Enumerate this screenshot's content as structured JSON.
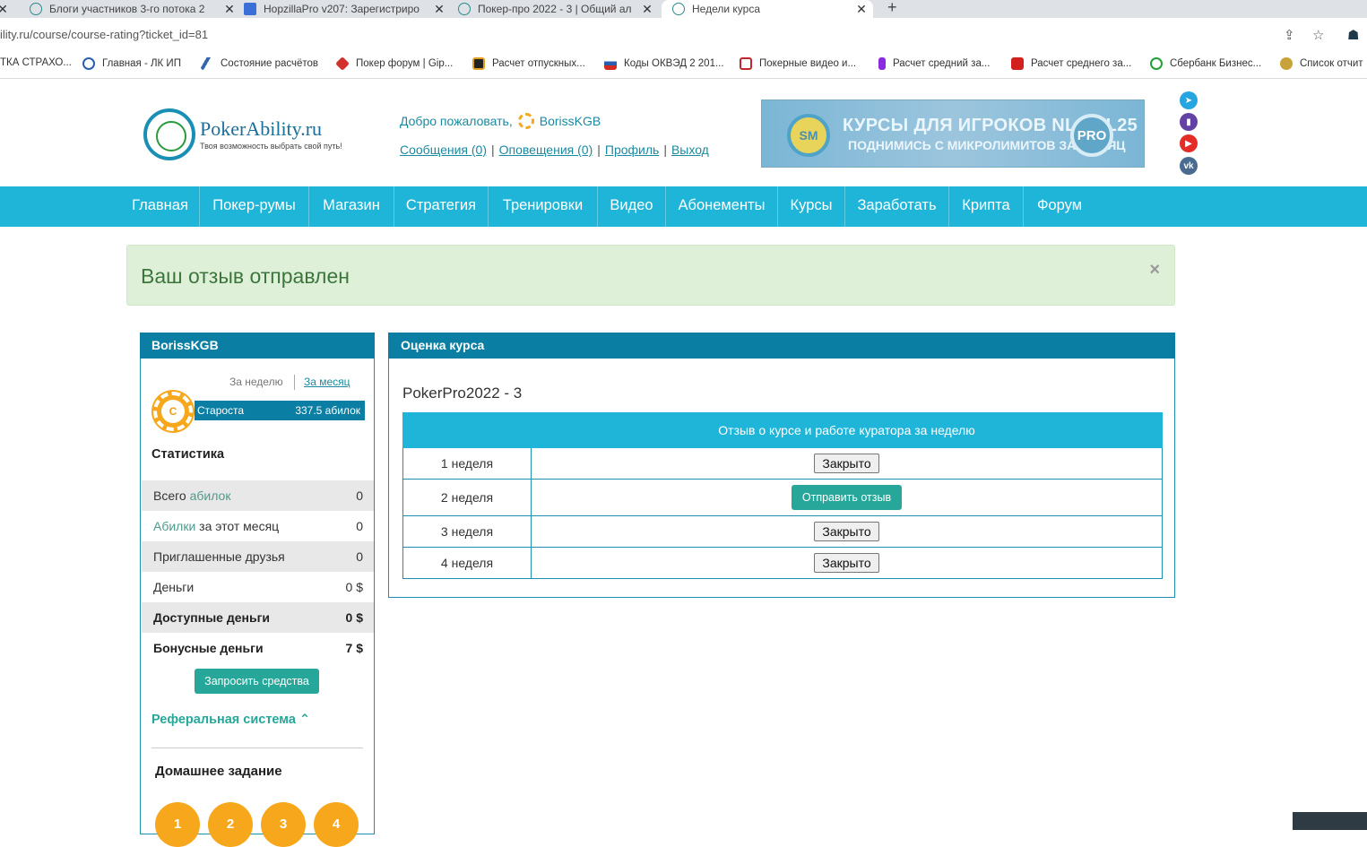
{
  "browser": {
    "tabs": [
      {
        "title": "Блоги участников 3-го потока 2",
        "active": false
      },
      {
        "title": "HopzillaPro v207: Зарегистриро",
        "active": false
      },
      {
        "title": "Покер-про 2022 - 3 | Общий ал",
        "active": false
      },
      {
        "title": "Недели курса",
        "active": true
      }
    ],
    "url": "ility.ru/course/course-rating?ticket_id=81",
    "bookmarks": [
      "ТКА СТРАХО...",
      "Главная - ЛК ИП",
      "Состояние расчётов",
      "Покер форум | Gip...",
      "Расчет отпускных...",
      "Коды ОКВЭД 2 201...",
      "Покерные видео и...",
      "Расчет средний за...",
      "Расчет среднего за...",
      "Сбербанк Бизнес...",
      "Список отчит"
    ]
  },
  "header": {
    "logo_name": "PokerAbility.ru",
    "logo_tagline": "Твоя возможность выбрать свой путь!",
    "welcome": "Добро пожаловать,",
    "username": "BorissKGB",
    "links": {
      "messages": "Сообщения (0)",
      "notifications": "Оповещения (0)",
      "profile": "Профиль",
      "logout": "Выход"
    },
    "banner": {
      "badge_left": "SM",
      "line1": "КУРСЫ ДЛЯ ИГРОКОВ NL2-NL25",
      "line2": "ПОДНИМИСЬ С МИКРОЛИМИТОВ ЗА МЕСЯЦ",
      "badge_right": "PRO"
    }
  },
  "nav": [
    "Главная",
    "Покер-румы",
    "Магазин",
    "Стратегия",
    "Тренировки",
    "Видео",
    "Абонементы",
    "Курсы",
    "Заработать",
    "Крипта",
    "Форум"
  ],
  "alert": {
    "message": "Ваш отзыв отправлен",
    "close": "×"
  },
  "sidebar": {
    "title": "BorissKGB",
    "period_week": "За неделю",
    "period_month": "За месяц",
    "chip_letter": "С",
    "rank": "Староста",
    "rank_value": "337.5 абилок",
    "stats_title": "Статистика",
    "stats": [
      {
        "pre": "Всего ",
        "hl": "абилок",
        "post": "",
        "value": "0"
      },
      {
        "pre": "",
        "hl": "Абилки",
        "post": " за этот месяц",
        "value": "0"
      },
      {
        "pre": "Приглашенные друзья",
        "hl": "",
        "post": "",
        "value": "0"
      },
      {
        "pre": "Деньги",
        "hl": "",
        "post": "",
        "value": "0 $"
      },
      {
        "pre": "Доступные деньги",
        "hl": "",
        "post": "",
        "value": "0 $"
      },
      {
        "pre": "Бонусные деньги",
        "hl": "",
        "post": "",
        "value": "7 $"
      }
    ],
    "request_button": "Запросить средства",
    "referral": "Реферальная система",
    "homework_title": "Домашнее задание",
    "homework": [
      "1",
      "2",
      "3",
      "4"
    ]
  },
  "main": {
    "title": "Оценка курса",
    "course_name": "PokerPro2022 - 3",
    "column_header": "Отзыв о курсе и работе куратора за неделю",
    "rows": [
      {
        "week": "1 неделя",
        "action": "Закрыто",
        "type": "closed"
      },
      {
        "week": "2 неделя",
        "action": "Отправить отзыв",
        "type": "send"
      },
      {
        "week": "3 неделя",
        "action": "Закрыто",
        "type": "closed"
      },
      {
        "week": "4 неделя",
        "action": "Закрыто",
        "type": "closed"
      }
    ]
  },
  "colors": {
    "nav": "#1fb5d9",
    "panel_header": "#0b7ea3",
    "green_button": "#26a79a",
    "alert_bg": "#dff0d8",
    "alert_text": "#3c763d",
    "accent_orange": "#f7a71b"
  }
}
